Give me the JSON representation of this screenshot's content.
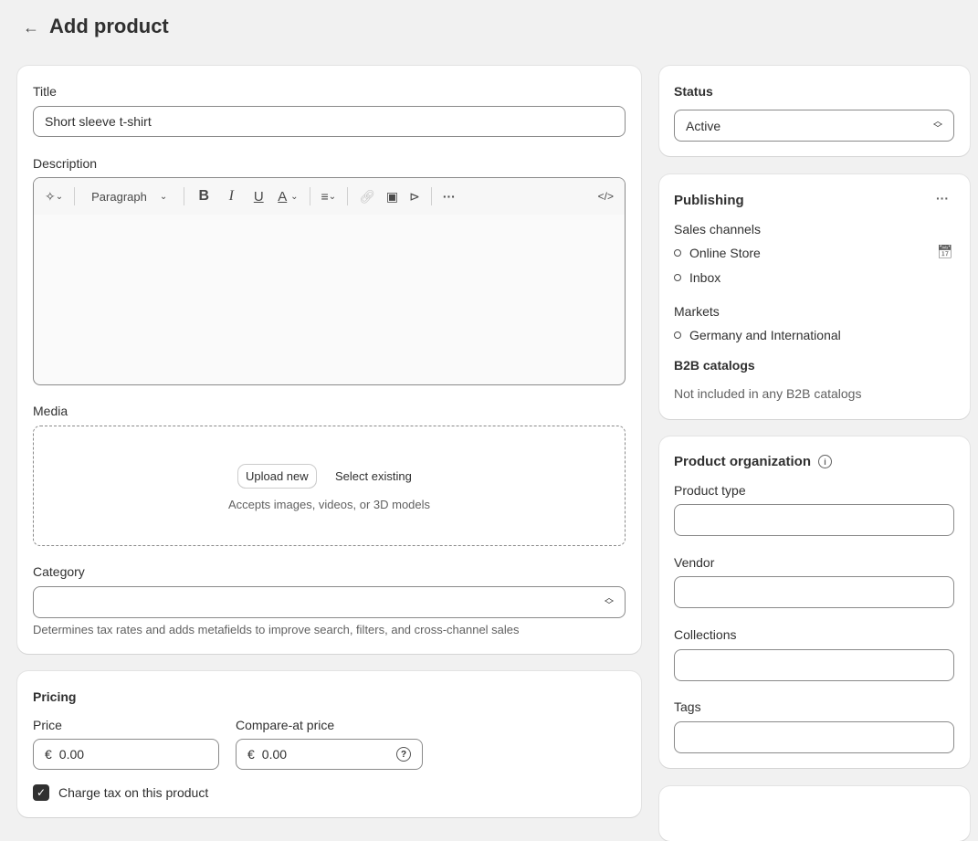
{
  "header": {
    "title": "Add product",
    "back_icon": "arrow-left-icon"
  },
  "main": {
    "title_label": "Title",
    "title_value": "Short sleeve t-shirt",
    "description_label": "Description",
    "toolbar": {
      "ai_icon": "sparkle-icon",
      "format_select": "Paragraph",
      "bold": "B",
      "italic": "I",
      "underline": "U",
      "color": "A",
      "icons": [
        "align-icon",
        "link-icon",
        "image-icon",
        "video-icon",
        "more-icon",
        "code-icon"
      ]
    },
    "media_label": "Media",
    "upload_new": "Upload new",
    "select_existing": "Select existing",
    "media_hint": "Accepts images, videos, or 3D models",
    "category_label": "Category",
    "category_value": "",
    "category_hint": "Determines tax rates and adds metafields to improve search, filters, and cross-channel sales",
    "pricing": {
      "heading": "Pricing",
      "price_label": "Price",
      "price_value": "0.00",
      "compare_label": "Compare-at price",
      "compare_value": "0.00",
      "currency": "€",
      "charge_tax_label": "Charge tax on this product",
      "charge_tax_checked": true
    }
  },
  "sidebar": {
    "status": {
      "heading": "Status",
      "value": "Active"
    },
    "publishing": {
      "heading": "Publishing",
      "sales_channels_label": "Sales channels",
      "channels": [
        "Online Store",
        "Inbox"
      ],
      "markets_label": "Markets",
      "markets": [
        "Germany and International"
      ],
      "b2b_label": "B2B catalogs",
      "b2b_text": "Not included in any B2B catalogs"
    },
    "organization": {
      "heading": "Product organization",
      "product_type_label": "Product type",
      "vendor_label": "Vendor",
      "collections_label": "Collections",
      "tags_label": "Tags"
    }
  }
}
